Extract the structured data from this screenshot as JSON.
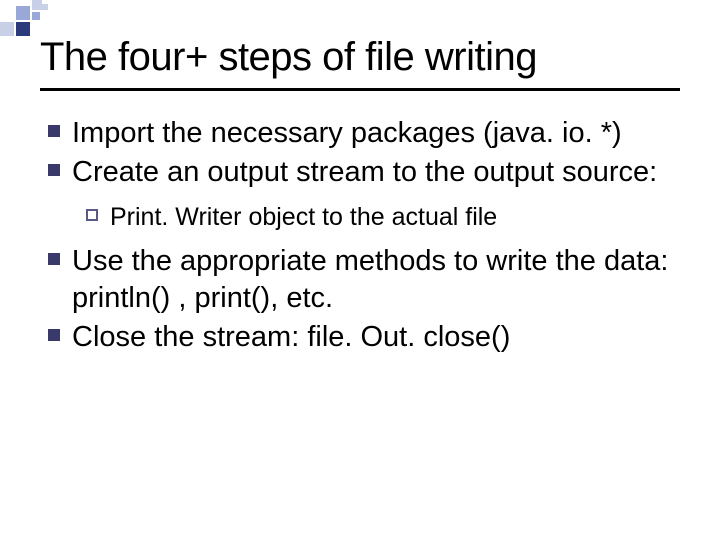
{
  "title": "The four+ steps of file writing",
  "bullets": {
    "b1": "Import the necessary packages (java. io. *)",
    "b2": "Create an output stream to the output source:",
    "b2a": "Print. Writer object to the actual file",
    "b3": "Use the appropriate methods to write the data: println() , print(), etc.",
    "b4": "Close the stream: file. Out. close()"
  },
  "deco": {
    "c_dark": "#2a3a7a",
    "c_mid": "#9aa8d8",
    "c_light": "#c8d0e8"
  }
}
